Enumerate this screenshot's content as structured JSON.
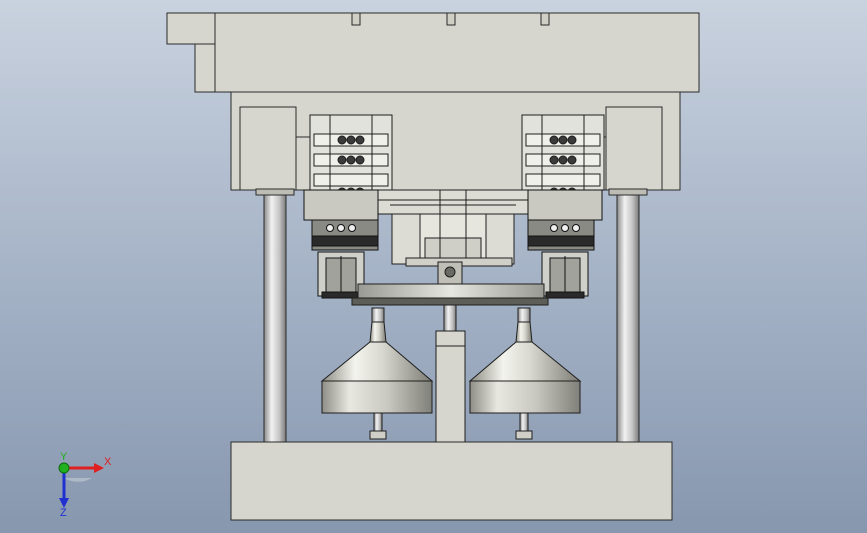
{
  "viewport": {
    "name": "3d-model-viewport"
  },
  "triad": {
    "x_label": "X",
    "y_label": "Y",
    "z_label": "Z",
    "x_color": "#e02020",
    "y_color": "#20b020",
    "z_color": "#2030d0"
  },
  "colors": {
    "plate": "#d6d6ce",
    "edge": "#2a2a2a",
    "steel_light": "#ececec",
    "steel_dark": "#707070"
  }
}
